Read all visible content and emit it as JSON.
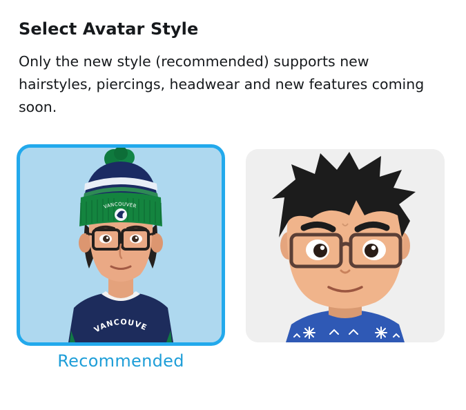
{
  "header": {
    "title": "Select Avatar Style",
    "description": "Only the new style (recommended) supports new hairstyles, piercings, headwear and new features coming soon."
  },
  "options": [
    {
      "id": "new-style",
      "selected": true,
      "caption": "Recommended",
      "beanie_text": "VANCOUVER",
      "jersey_text": "VANCOUVER",
      "background_color": "#aed8ef",
      "border_color": "#22a9ec"
    },
    {
      "id": "classic-style",
      "selected": false,
      "background_color": "#efefef"
    }
  ],
  "colors": {
    "accent": "#22a9ec",
    "caption": "#1e9ed8"
  }
}
